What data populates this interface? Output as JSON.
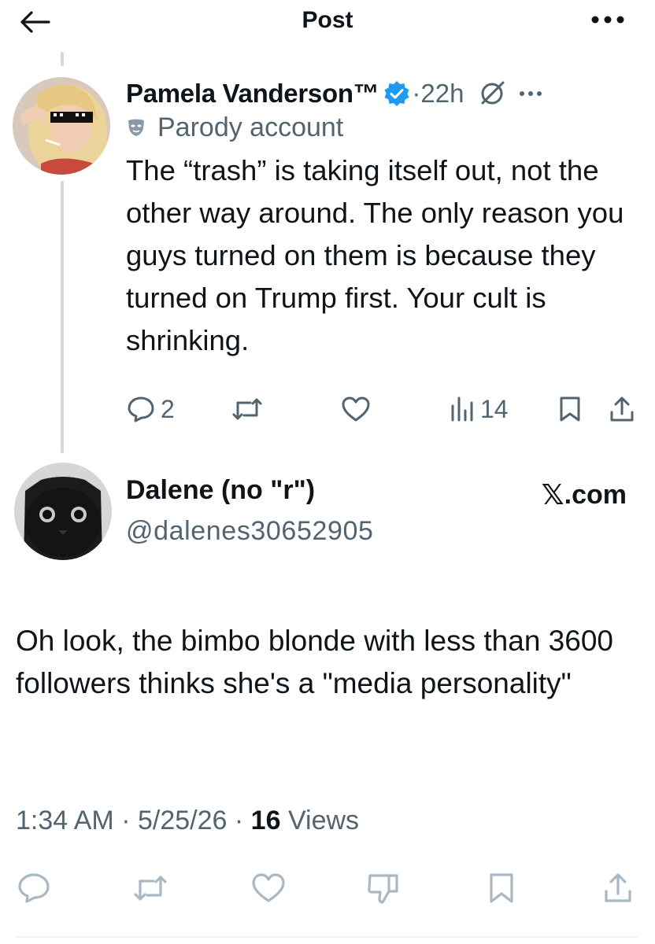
{
  "header": {
    "title": "Post",
    "back_icon": "arrow-left-icon",
    "more_icon": "more-horizontal-icon"
  },
  "parent_post": {
    "author_name": "Pamela Vanderson™",
    "verified": true,
    "separator": "·",
    "time": "22h",
    "account_label": "Parody account",
    "text": "The “trash” is taking itself out, not the other way around. The only reason you guys turned on them is because they turned on Trump first. Your cult is shrinking.",
    "actions": {
      "replies": "2",
      "reposts": "",
      "likes": "",
      "views": "14"
    }
  },
  "quoted_user": {
    "display_name": "Dalene (no \"r\")",
    "handle": "@dalenes30652905",
    "source_label": "X.com"
  },
  "reply": {
    "text": "Oh look, the bimbo blonde with less than 3600 followers thinks she's a \"media personality\"",
    "time": "1:34 AM",
    "separator": "·",
    "date": "5/25/26",
    "views_count": "16",
    "views_label": "Views"
  },
  "colors": {
    "text_primary": "#0f1419",
    "text_secondary": "#536471",
    "icon_light": "#a9b8c3",
    "verified_blue": "#1d9bf0",
    "thread_line": "#cfd9de"
  }
}
